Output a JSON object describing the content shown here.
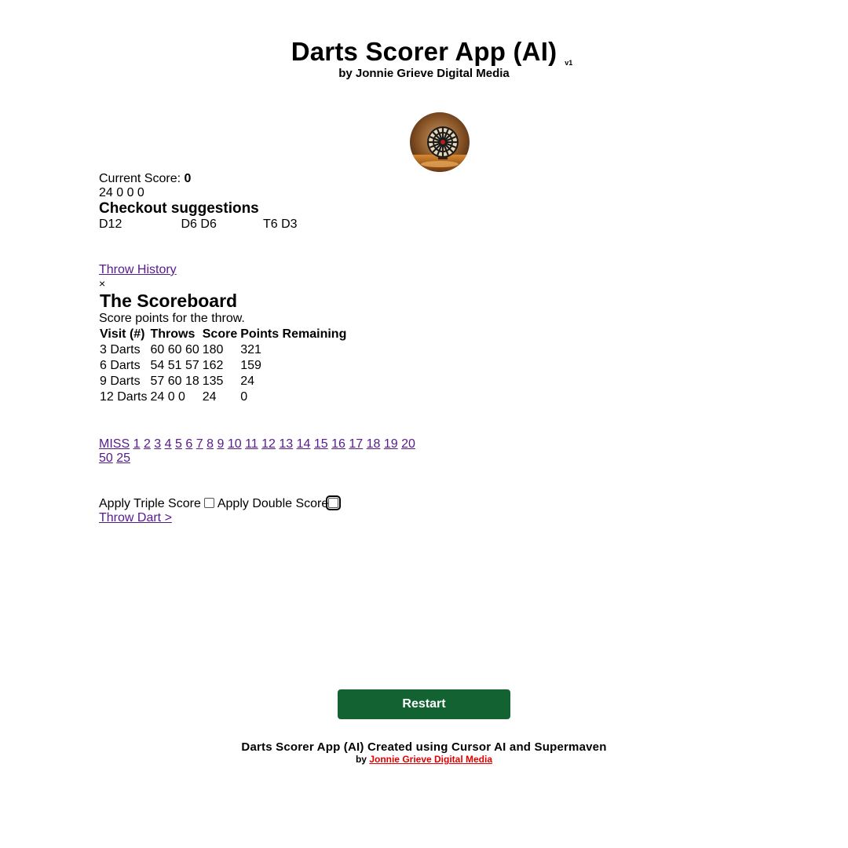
{
  "header": {
    "title": "Darts Scorer App (AI)",
    "version": "v1",
    "byline": "by Jonnie Grieve Digital Media"
  },
  "avatar": {
    "icon": "dartboard-avatar-icon"
  },
  "game": {
    "current_score_label": "Current Score: ",
    "current_score_value": "0",
    "last_throws": "24 0 0 0",
    "checkout_heading": "Checkout suggestions",
    "checkout_suggestions": [
      "D12",
      "D6 D6",
      "T6 D3"
    ]
  },
  "history": {
    "link_label": "Throw History",
    "close_label": "×",
    "title": "The Scoreboard",
    "description": "Score points for the throw.",
    "columns": [
      "Visit (#)",
      "Throws",
      "Score",
      "Points Remaining"
    ],
    "rows": [
      [
        "3 Darts",
        "60 60 60",
        "180",
        "321"
      ],
      [
        "6 Darts",
        "54 51 57",
        "162",
        "159"
      ],
      [
        "9 Darts",
        "57 60 18",
        "135",
        "24"
      ],
      [
        "12 Darts",
        "24 0 0",
        "24",
        "0"
      ]
    ]
  },
  "score_buttons": [
    "MISS",
    "1",
    "2",
    "3",
    "4",
    "5",
    "6",
    "7",
    "8",
    "9",
    "10",
    "11",
    "12",
    "13",
    "14",
    "15",
    "16",
    "17",
    "18",
    "19",
    "20",
    "50",
    "25"
  ],
  "options": {
    "triple_label": "Apply Triple Score",
    "double_label": "Apply Double Score",
    "throw_dart_label": "Throw Dart >"
  },
  "restart_label": "Restart",
  "footer": {
    "line1": "Darts Scorer App (AI) Created using Cursor AI and Supermaven",
    "by_label": "by ",
    "link_label": "Jonnie Grieve Digital Media"
  },
  "colors": {
    "link": "#551a8b",
    "restart_button": "#136332",
    "footer_link": "#e00000"
  }
}
